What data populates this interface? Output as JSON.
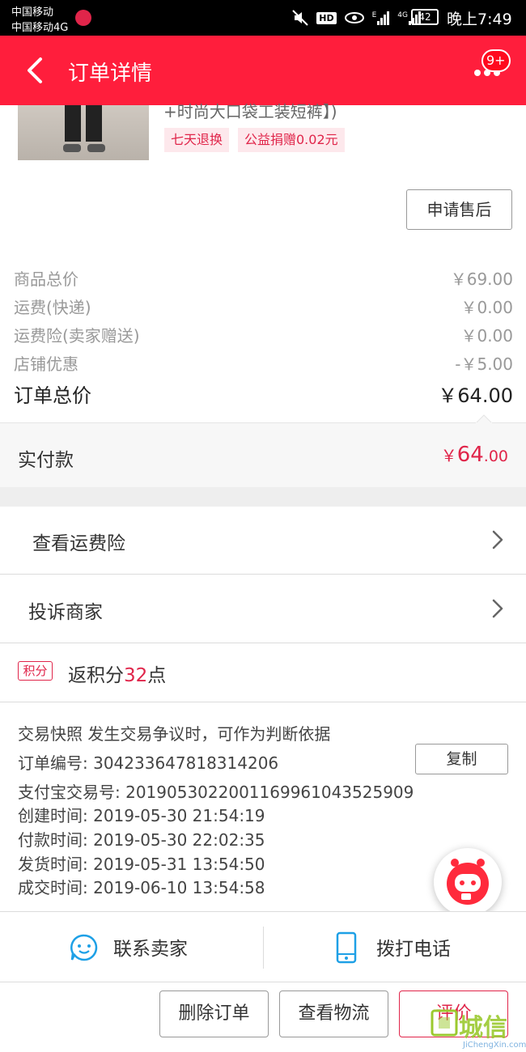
{
  "status_bar": {
    "carrier1": "中国移动",
    "carrier2": "中国移动4G",
    "hd": "HD",
    "net1": "E",
    "net2": "4G",
    "battery": "42",
    "time": "晚上7:49"
  },
  "header": {
    "title": "订单详情",
    "badge": "9+",
    "bg_color": "#ff1e3c"
  },
  "product": {
    "name_partial": "+时尚大口袋工装短裤】)",
    "tags": [
      "七天退换",
      "公益捐赠0.02元"
    ],
    "after_sale_button": "申请售后"
  },
  "prices": {
    "rows": [
      {
        "label": "商品总价",
        "value": "￥69.00"
      },
      {
        "label": "运费(快递)",
        "value": "￥0.00"
      },
      {
        "label": "运费险(卖家赠送)",
        "value": "￥0.00"
      },
      {
        "label": "店铺优惠",
        "value": "-￥5.00"
      }
    ],
    "total_label": "订单总价",
    "total_value": "￥64.00",
    "paid_label": "实付款",
    "paid_currency": "￥",
    "paid_int": "64",
    "paid_dec": ".00"
  },
  "links": [
    {
      "label": "查看运费险"
    },
    {
      "label": "投诉商家"
    }
  ],
  "points": {
    "tag": "积分",
    "prefix": "返积分",
    "num": "32",
    "suffix": "点"
  },
  "snapshot": {
    "title": "交易快照  发生交易争议时，可作为判断依据",
    "order_no": "订单编号: 304233647818314206",
    "copy_button": "复制",
    "alipay_no": "支付宝交易号: 2019053022001169961043525909",
    "created": "创建时间: 2019-05-30 21:54:19",
    "paid": "付款时间: 2019-05-30 22:02:35",
    "shipped": "发货时间: 2019-05-31 13:54:50",
    "completed": "成交时间: 2019-06-10 13:54:58"
  },
  "contact": {
    "seller": "联系卖家",
    "phone": "拨打电话"
  },
  "actions": {
    "delete": "删除订单",
    "logistics": "查看物流",
    "review": "评价"
  },
  "watermark": {
    "text": "城信",
    "sub": "JiChengXin.com"
  },
  "colors": {
    "accent": "#e0254a",
    "icon_blue": "#1ea0e6"
  }
}
